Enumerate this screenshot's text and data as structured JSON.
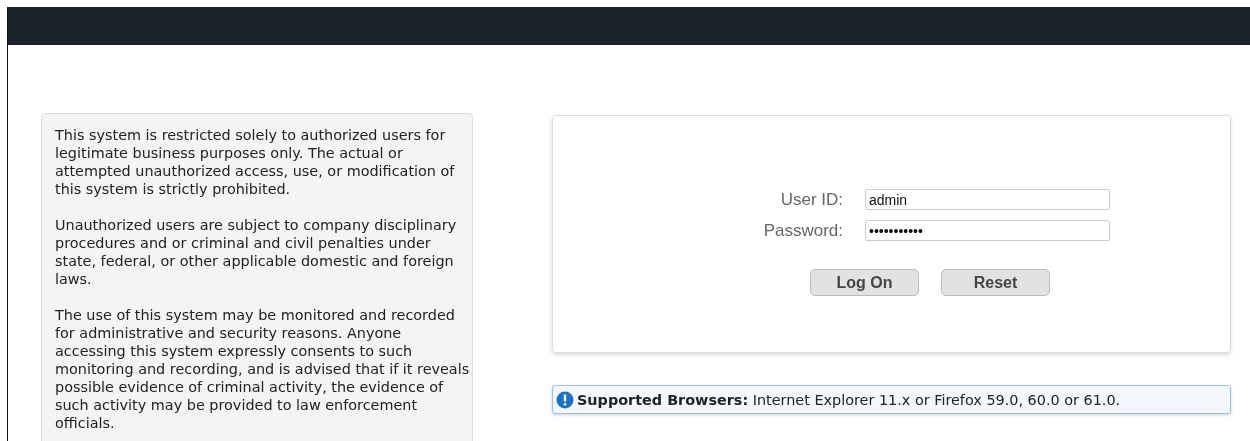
{
  "notice": {
    "paragraphs": [
      "This system is restricted solely to authorized users for legitimate business purposes only. The actual or attempted unauthorized access, use, or modification of this system is strictly prohibited.",
      "Unauthorized users are subject to company disciplinary procedures and or criminal and civil penalties under state, federal, or other applicable domestic and foreign laws.",
      "The use of this system may be monitored and recorded for administrative and security reasons. Anyone accessing this system expressly consents to such monitoring and recording, and is advised that if it reveals possible evidence of criminal activity, the evidence of such activity may be provided to law enforcement officials."
    ]
  },
  "login": {
    "fields": [
      {
        "label": "User ID:",
        "value": "admin"
      },
      {
        "label": "Password:",
        "value": "•••••••••••"
      }
    ],
    "buttons": [
      "Log On",
      "Reset"
    ]
  },
  "info": {
    "text": "**Supported Browsers:** Internet Explorer 11.x or Firefox 59.0, 60.0 or 61.0."
  }
}
